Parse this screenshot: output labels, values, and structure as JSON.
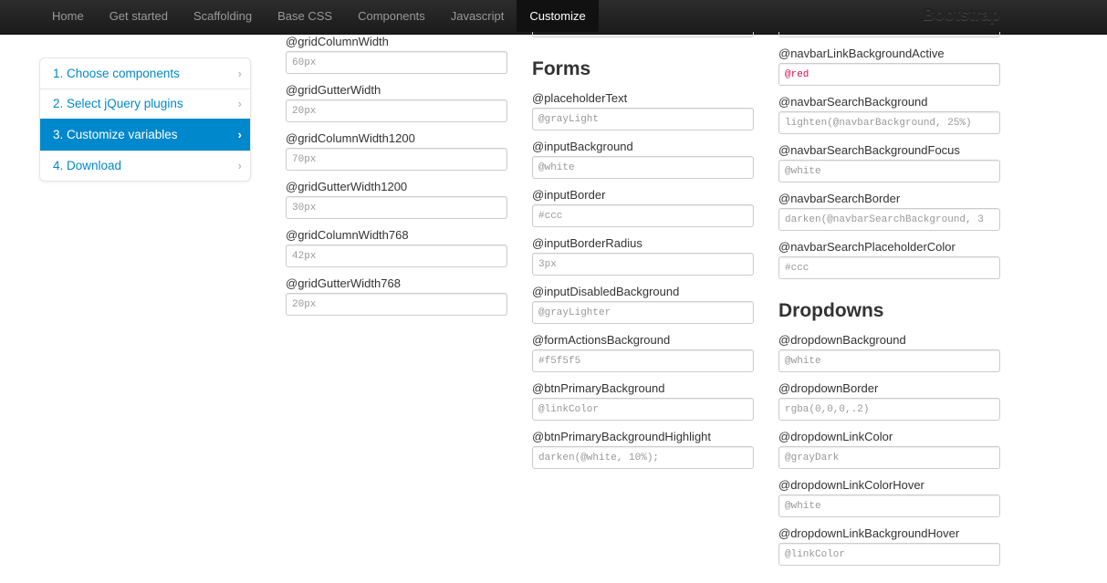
{
  "navbar": {
    "items": [
      "Home",
      "Get started",
      "Scaffolding",
      "Base CSS",
      "Components",
      "Javascript",
      "Customize"
    ],
    "active": "Customize",
    "brand": "Bootstrap"
  },
  "sidebar": {
    "items": [
      {
        "label": "1. Choose components"
      },
      {
        "label": "2. Select jQuery plugins"
      },
      {
        "label": "3. Customize variables"
      },
      {
        "label": "4. Download"
      }
    ],
    "active_index": 2
  },
  "col1": {
    "fields": [
      {
        "label": "@gridColumnWidth",
        "placeholder": "60px"
      },
      {
        "label": "@gridGutterWidth",
        "placeholder": "20px"
      },
      {
        "label": "@gridColumnWidth1200",
        "placeholder": "70px"
      },
      {
        "label": "@gridGutterWidth1200",
        "placeholder": "30px"
      },
      {
        "label": "@gridColumnWidth768",
        "placeholder": "42px"
      },
      {
        "label": "@gridGutterWidth768",
        "placeholder": "20px"
      }
    ]
  },
  "col2": {
    "section_title": "Forms",
    "fields": [
      {
        "label": "@placeholderText",
        "placeholder": "@grayLight"
      },
      {
        "label": "@inputBackground",
        "placeholder": "@white"
      },
      {
        "label": "@inputBorder",
        "placeholder": "#ccc"
      },
      {
        "label": "@inputBorderRadius",
        "placeholder": "3px"
      },
      {
        "label": "@inputDisabledBackground",
        "placeholder": "@grayLighter"
      },
      {
        "label": "@formActionsBackground",
        "placeholder": "#f5f5f5"
      },
      {
        "label": "@btnPrimaryBackground",
        "placeholder": "@linkColor"
      },
      {
        "label": "@btnPrimaryBackgroundHighlight",
        "placeholder": "darken(@white, 10%);"
      }
    ]
  },
  "col3": {
    "fields_top": [
      {
        "label": "@navbarLinkBackgroundActive",
        "placeholder": "@red"
      },
      {
        "label": "@navbarSearchBackground",
        "placeholder": "lighten(@navbarBackground, 25%)"
      },
      {
        "label": "@navbarSearchBackgroundFocus",
        "placeholder": "@white"
      },
      {
        "label": "@navbarSearchBorder",
        "placeholder": "darken(@navbarSearchBackground, 3"
      },
      {
        "label": "@navbarSearchPlaceholderColor",
        "placeholder": "#ccc"
      }
    ],
    "section_title": "Dropdowns",
    "fields_bottom": [
      {
        "label": "@dropdownBackground",
        "placeholder": "@white"
      },
      {
        "label": "@dropdownBorder",
        "placeholder": "rgba(0,0,0,.2)"
      },
      {
        "label": "@dropdownLinkColor",
        "placeholder": "@grayDark"
      },
      {
        "label": "@dropdownLinkColorHover",
        "placeholder": "@white"
      },
      {
        "label": "@dropdownLinkBackgroundHover",
        "placeholder": "@linkColor"
      }
    ]
  },
  "colors": {
    "accent": "#0088cc",
    "navbar": "#1b1b1b",
    "red_value": "#dd1144"
  }
}
